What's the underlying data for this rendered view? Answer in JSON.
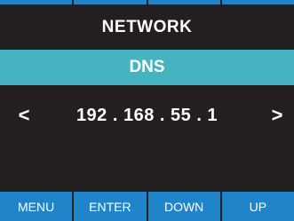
{
  "header": {
    "title": "NETWORK"
  },
  "section": {
    "label": "DNS"
  },
  "field": {
    "value": "192 . 168 . 55 . 1",
    "prev_glyph": "<",
    "next_glyph": ">"
  },
  "softkeys": [
    {
      "label": "MENU"
    },
    {
      "label": "ENTER"
    },
    {
      "label": "DOWN"
    },
    {
      "label": "UP"
    }
  ],
  "colors": {
    "background": "#231f20",
    "section_bar": "#45b3c1",
    "softkey": "#1f84c9",
    "text": "#ffffff"
  }
}
